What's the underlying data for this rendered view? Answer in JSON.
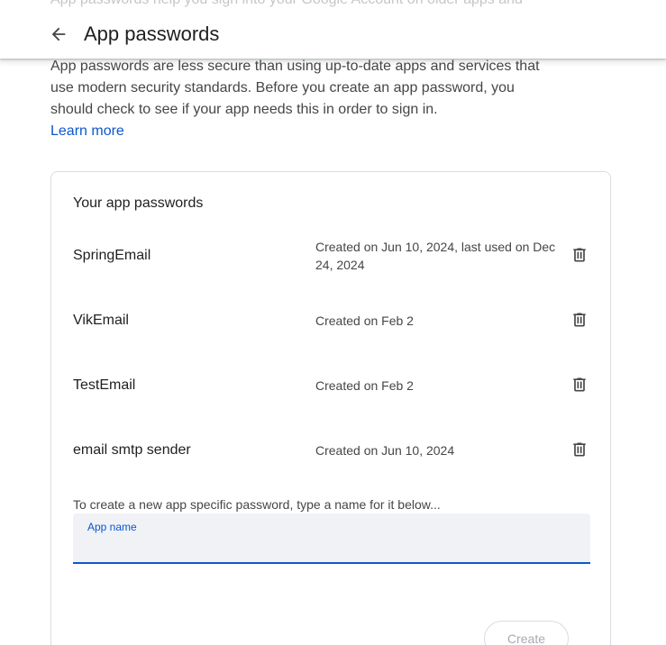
{
  "header": {
    "ghost_text": "App passwords help you sign into your Google Account on older apps and",
    "back_icon": "arrow-back-icon",
    "title": "App passwords"
  },
  "intro": {
    "text": "App passwords are less secure than using up-to-date apps and services that use modern security standards. Before you create an app password, you should check to see if your app needs this in order to sign in.",
    "learn_more": "Learn more"
  },
  "card": {
    "title": "Your app passwords",
    "passwords": [
      {
        "name": "SpringEmail",
        "meta": "Created on Jun 10, 2024, last used on Dec 24, 2024",
        "delete_icon": "trash-icon"
      },
      {
        "name": "VikEmail",
        "meta": "Created on Feb 2",
        "delete_icon": "trash-icon"
      },
      {
        "name": "TestEmail",
        "meta": "Created on Feb 2",
        "delete_icon": "trash-icon"
      },
      {
        "name": "email smtp sender",
        "meta": "Created on Jun 10, 2024",
        "delete_icon": "trash-icon"
      }
    ],
    "create_hint": "To create a new app specific password, type a name for it below...",
    "app_name_field": {
      "label": "App name",
      "value": ""
    },
    "create_button": "Create"
  },
  "colors": {
    "accent": "#0b57d0",
    "text_primary": "#1f1f1f",
    "text_secondary": "#444746",
    "field_bg": "#f0f2f5",
    "border": "#dadce0",
    "disabled_text": "#a8abaf"
  }
}
